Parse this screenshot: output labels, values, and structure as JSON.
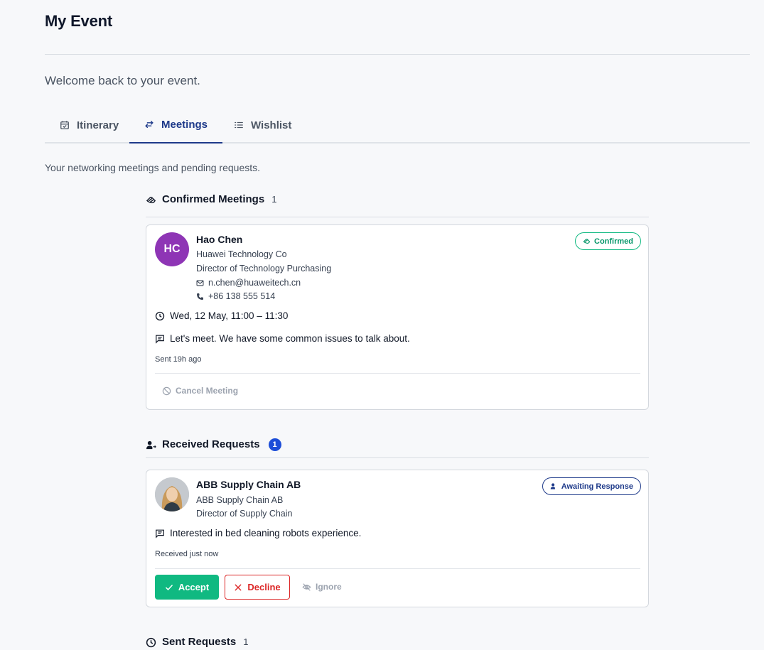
{
  "page": {
    "title": "My Event",
    "welcome": "Welcome back to your event.",
    "intro": "Your networking meetings and pending requests."
  },
  "tabs": [
    {
      "label": "Itinerary",
      "icon": "calendar-check-icon",
      "active": false
    },
    {
      "label": "Meetings",
      "icon": "arrows-swap-icon",
      "active": true
    },
    {
      "label": "Wishlist",
      "icon": "list-icon",
      "active": false
    }
  ],
  "colors": {
    "accent": "#1e3a8a",
    "confirmed": "#10b981",
    "decline": "#dc2626",
    "avatar": "#8e35b5"
  },
  "confirmed": {
    "title": "Confirmed Meetings",
    "count": "1",
    "meeting": {
      "initials": "HC",
      "name": "Hao Chen",
      "company": "Huawei Technology Co",
      "role": "Director of Technology Purchasing",
      "email": "n.chen@huaweitech.cn",
      "phone": "+86 138 555 514",
      "status": "Confirmed",
      "time": "Wed, 12 May, 11:00 – 11:30",
      "message": "Let's meet. We have some common issues to talk about.",
      "sent": "Sent 19h ago",
      "cancel_label": "Cancel Meeting"
    }
  },
  "received": {
    "title": "Received Requests",
    "count": "1",
    "request": {
      "name": "ABB Supply Chain AB",
      "company": "ABB Supply Chain AB",
      "role": "Director of Supply Chain",
      "status": "Awaiting Response",
      "message": "Interested in bed cleaning robots experience.",
      "received": "Received just now",
      "accept_label": "Accept",
      "decline_label": "Decline",
      "ignore_label": "Ignore"
    }
  },
  "sent": {
    "title": "Sent Requests",
    "count": "1"
  }
}
